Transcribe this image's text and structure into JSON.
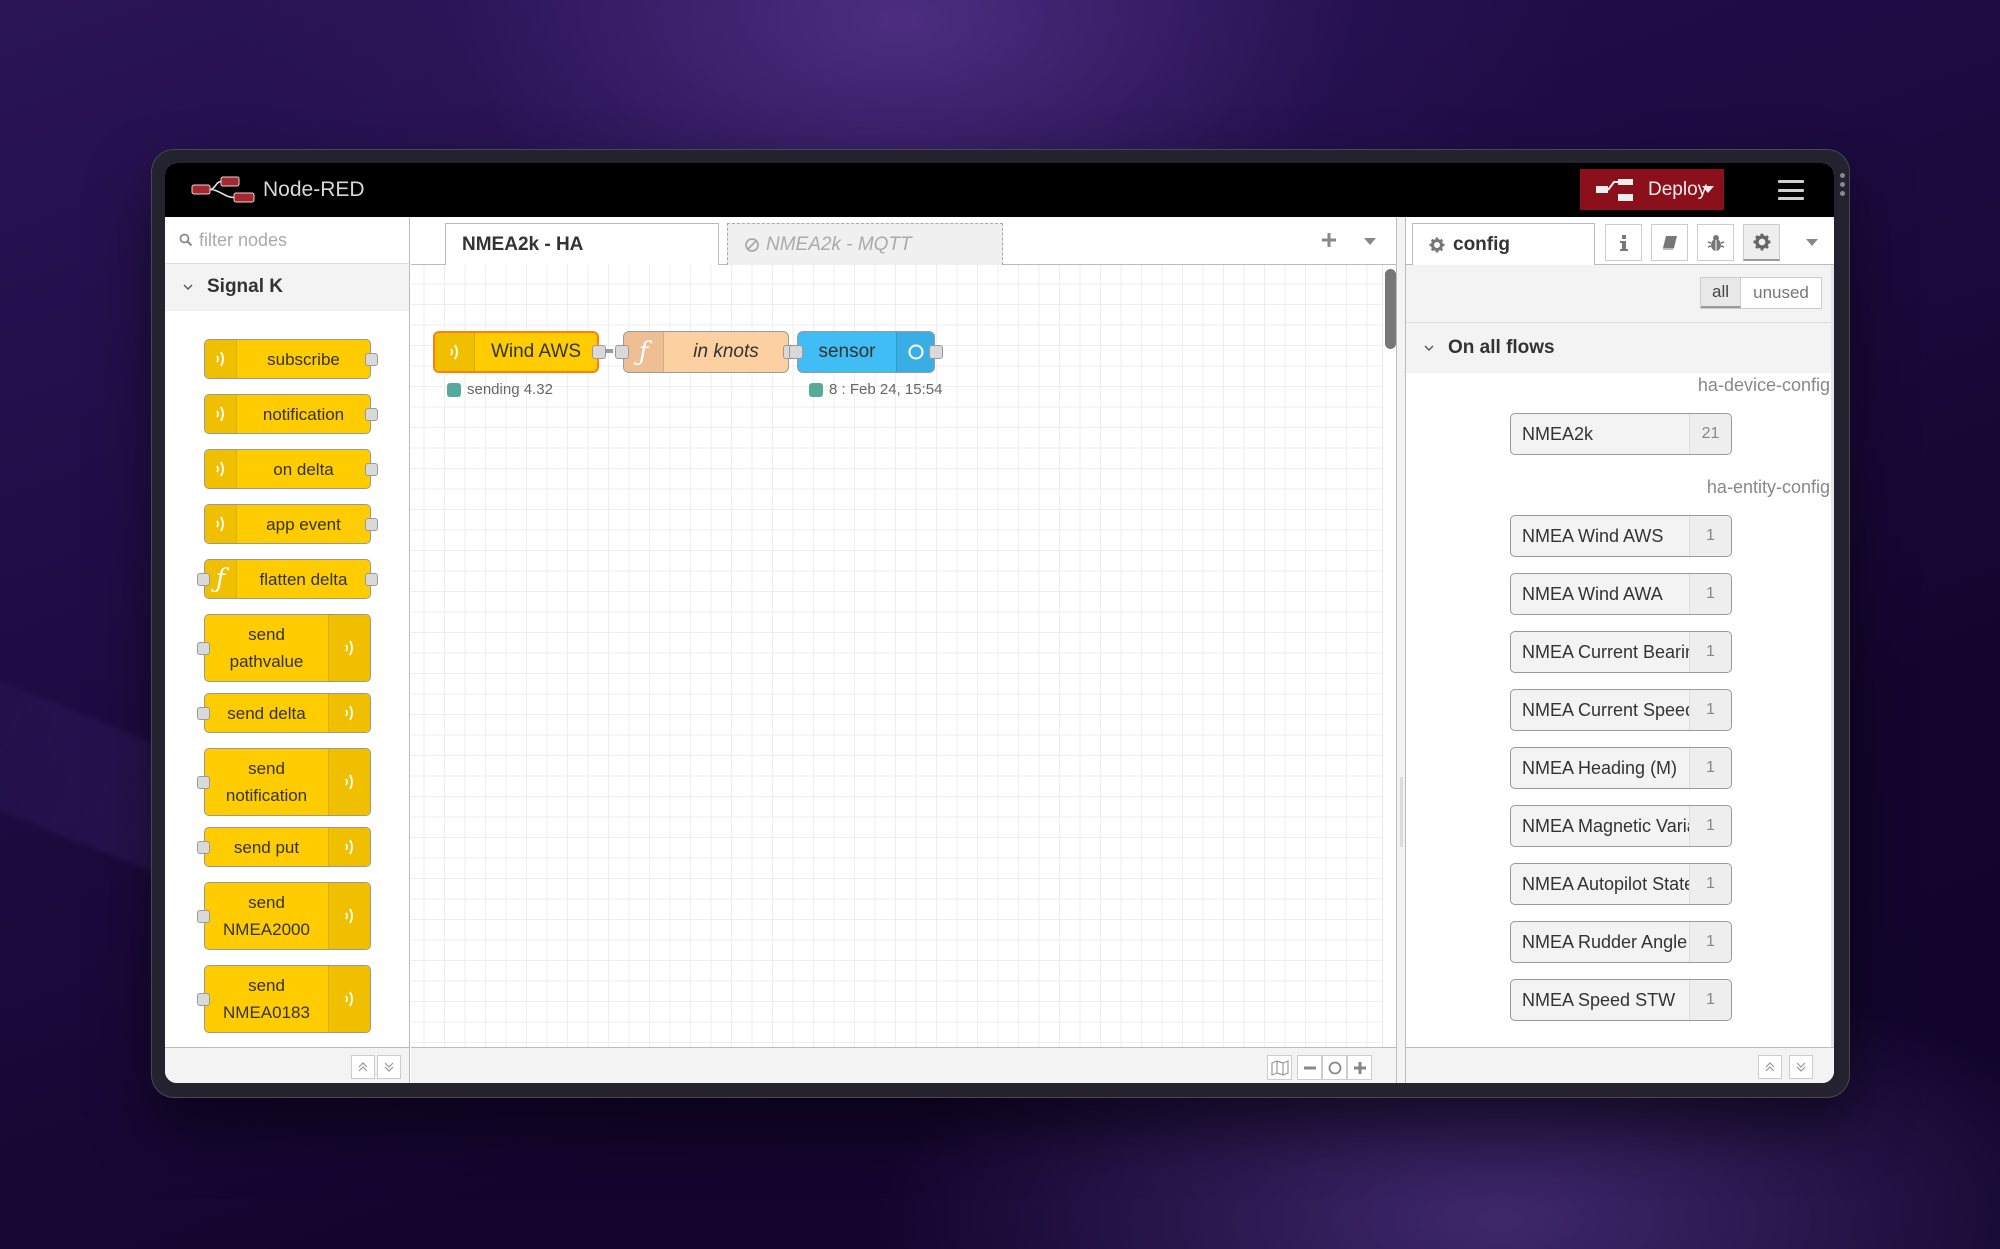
{
  "app": {
    "title": "Node-RED",
    "deploy_label": "Deploy",
    "colors": {
      "deploy": "#8c101c",
      "header": "#000000",
      "signalk_node": "#ffcc00",
      "function_node": "#fdd0a2",
      "sensor_node": "#41bdf5"
    }
  },
  "palette": {
    "filter_placeholder": "filter nodes",
    "category": "Signal K",
    "nodes": [
      {
        "label": "subscribe",
        "icon": "signal-icon",
        "icon_side": "left",
        "ports": "out"
      },
      {
        "label": "notification",
        "icon": "signal-icon",
        "icon_side": "left",
        "ports": "out"
      },
      {
        "label": "on delta",
        "icon": "signal-icon",
        "icon_side": "left",
        "ports": "out"
      },
      {
        "label": "app event",
        "icon": "signal-icon",
        "icon_side": "left",
        "ports": "out"
      },
      {
        "label": "flatten delta",
        "icon": "function-icon",
        "icon_side": "left",
        "ports": "both"
      },
      {
        "label": "send pathvalue",
        "line1": "send",
        "line2": "pathvalue",
        "icon": "signal-icon",
        "icon_side": "right",
        "ports": "in"
      },
      {
        "label": "send delta",
        "icon": "signal-icon",
        "icon_side": "right",
        "ports": "in"
      },
      {
        "label": "send notification",
        "line1": "send",
        "line2": "notification",
        "icon": "signal-icon",
        "icon_side": "right",
        "ports": "in"
      },
      {
        "label": "send put",
        "icon": "signal-icon",
        "icon_side": "right",
        "ports": "in"
      },
      {
        "label": "send NMEA2000",
        "line1": "send",
        "line2": "NMEA2000",
        "icon": "signal-icon",
        "icon_side": "right",
        "ports": "in"
      },
      {
        "label": "send NMEA0183",
        "line1": "send",
        "line2": "NMEA0183",
        "icon": "signal-icon",
        "icon_side": "right",
        "ports": "in"
      }
    ]
  },
  "workspace": {
    "tabs": [
      {
        "label": "NMEA2k - HA",
        "active": true,
        "disabled": false
      },
      {
        "label": "NMEA2k - MQTT",
        "active": false,
        "disabled": true
      }
    ],
    "flow_nodes": [
      {
        "label": "Wind AWS",
        "type": "signalk-subscribe",
        "status": "sending 4.32"
      },
      {
        "label": "in knots",
        "type": "function",
        "status": ""
      },
      {
        "label": "sensor",
        "type": "ha-sensor",
        "status": "8 : Feb 24, 15:54"
      }
    ]
  },
  "sidebar": {
    "active_tab": "config",
    "filter": {
      "all": "all",
      "unused": "unused",
      "selected": "all"
    },
    "group": "On all flows",
    "sections": [
      {
        "type": "ha-device-config",
        "items": [
          {
            "name": "NMEA2k",
            "count": "21"
          }
        ]
      },
      {
        "type": "ha-entity-config",
        "items": [
          {
            "name": "NMEA Wind AWS",
            "count": "1"
          },
          {
            "name": "NMEA Wind AWA",
            "count": "1"
          },
          {
            "name": "NMEA Current Bearing",
            "count": "1"
          },
          {
            "name": "NMEA Current Speed",
            "count": "1"
          },
          {
            "name": "NMEA Heading (M)",
            "count": "1"
          },
          {
            "name": "NMEA Magnetic Variation",
            "count": "1"
          },
          {
            "name": "NMEA Autopilot State",
            "count": "1"
          },
          {
            "name": "NMEA Rudder Angle",
            "count": "1"
          },
          {
            "name": "NMEA Speed STW",
            "count": "1"
          }
        ]
      }
    ]
  }
}
